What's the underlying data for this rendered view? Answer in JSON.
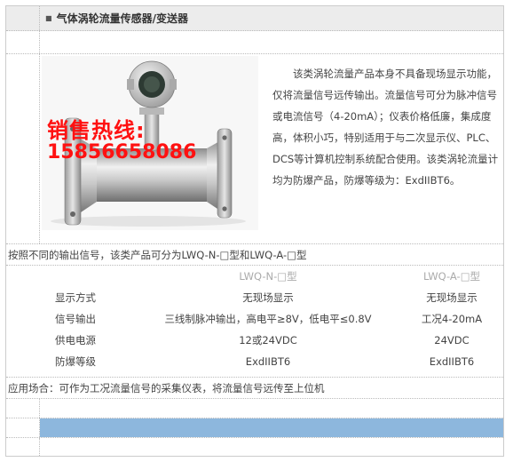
{
  "title": {
    "bullet": "■",
    "text": "气体涡轮流量传感器/变送器"
  },
  "product": {
    "watermark_line1": "销售热线:",
    "watermark_line2": "15856658086",
    "description": "该类涡轮流量产品本身不具备现场显示功能，仅将流量信号远传输出。流量信号可分为脉冲信号或电流信号（4-20mA）；仪表价格低廉，集成度高，体积小巧，特别适用于与二次显示仪、PLC、DCS等计算机控制系统配合使用。该类涡轮流量计均为防爆产品，防爆等级为：ExdIIBT6。"
  },
  "intro": "按照不同的输出信号，该类产品可分为LWQ-N-□型和LWQ-A-□型",
  "spec_table": {
    "columns": [
      "",
      "LWQ-N-□型",
      "LWQ-A-□型"
    ],
    "rows": [
      {
        "label": "显示方式",
        "n": "无现场显示",
        "a": "无现场显示"
      },
      {
        "label": "信号输出",
        "n": "三线制脉冲输出，高电平≥8V，低电平≤0.8V",
        "a": "工况4-20mA"
      },
      {
        "label": "供电电源",
        "n": "12或24VDC",
        "a": "24VDC"
      },
      {
        "label": "防爆等级",
        "n": "ExdIIBT6",
        "a": "ExdIIBT6"
      }
    ]
  },
  "application": "应用场合：可作为工况流量信号的采集仪表，将流量信号远传至上位机",
  "colors": {
    "title_bg": "#ececec",
    "watermark": "#ff1111",
    "blue_bar": "#8db7dd",
    "border": "#cccccc"
  }
}
